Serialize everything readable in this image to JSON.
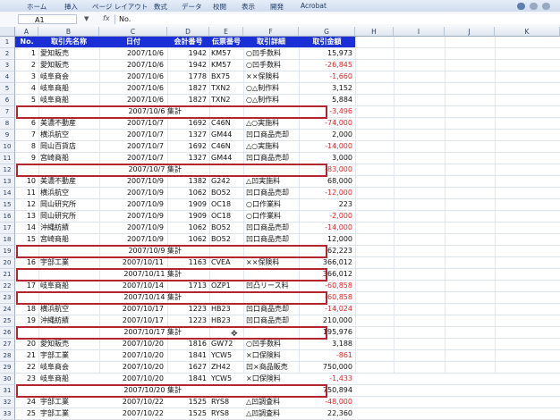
{
  "ribbon": {
    "tabs": [
      "ホーム",
      "挿入",
      "ページ レイアウト",
      "数式",
      "データ",
      "校閲",
      "表示",
      "開発",
      "Acrobat"
    ]
  },
  "formula_bar": {
    "name_box": "A1",
    "fx": "fx",
    "value": "No."
  },
  "columns": [
    "A",
    "B",
    "C",
    "D",
    "E",
    "F",
    "G",
    "H",
    "I",
    "J",
    "K"
  ],
  "header": [
    "No.",
    "取引先名称",
    "日付",
    "会計番号",
    "伝票番号",
    "取引詳細",
    "取引金額"
  ],
  "rows": [
    {
      "row": "2",
      "no": "1",
      "name": "愛知販売",
      "date": "2007/10/6",
      "acct": "1942",
      "slip": "KM57",
      "detail": "○凹手数料",
      "amount": "15,973",
      "neg": false
    },
    {
      "row": "3",
      "no": "2",
      "name": "愛知販売",
      "date": "2007/10/6",
      "acct": "1942",
      "slip": "KM57",
      "detail": "○凹手数料",
      "amount": "-26,845",
      "neg": true
    },
    {
      "row": "4",
      "no": "3",
      "name": "岐阜商会",
      "date": "2007/10/6",
      "acct": "1778",
      "slip": "BX75",
      "detail": "××保険料",
      "amount": "-1,660",
      "neg": true
    },
    {
      "row": "5",
      "no": "4",
      "name": "岐阜商船",
      "date": "2007/10/6",
      "acct": "1827",
      "slip": "TXN2",
      "detail": "○△制作料",
      "amount": "3,152",
      "neg": false
    },
    {
      "row": "6",
      "no": "5",
      "name": "岐阜商船",
      "date": "2007/10/6",
      "acct": "1827",
      "slip": "TXN2",
      "detail": "○△制作料",
      "amount": "5,884",
      "neg": false
    },
    {
      "row": "7",
      "subtotal": "2007/10/6 集計",
      "amount": "-3,496",
      "neg": true
    },
    {
      "row": "8",
      "no": "6",
      "name": "美濃不動産",
      "date": "2007/10/7",
      "acct": "1692",
      "slip": "C46N",
      "detail": "△○実施料",
      "amount": "-74,000",
      "neg": true
    },
    {
      "row": "9",
      "no": "7",
      "name": "横浜航空",
      "date": "2007/10/7",
      "acct": "1327",
      "slip": "GM44",
      "detail": "凹口商品売却",
      "amount": "2,000",
      "neg": false
    },
    {
      "row": "10",
      "no": "8",
      "name": "岡山百貨店",
      "date": "2007/10/7",
      "acct": "1692",
      "slip": "C46N",
      "detail": "△○実施料",
      "amount": "-14,000",
      "neg": true
    },
    {
      "row": "11",
      "no": "9",
      "name": "宮崎商船",
      "date": "2007/10/7",
      "acct": "1327",
      "slip": "GM44",
      "detail": "凹口商品売却",
      "amount": "3,000",
      "neg": false
    },
    {
      "row": "12",
      "subtotal": "2007/10/7 集計",
      "amount": "-83,000",
      "neg": true
    },
    {
      "row": "13",
      "no": "10",
      "name": "美濃不動産",
      "date": "2007/10/9",
      "acct": "1382",
      "slip": "G242",
      "detail": "△凹実施料",
      "amount": "68,000",
      "neg": false
    },
    {
      "row": "14",
      "no": "11",
      "name": "横浜航空",
      "date": "2007/10/9",
      "acct": "1062",
      "slip": "BO52",
      "detail": "凹口商品売却",
      "amount": "-12,000",
      "neg": true
    },
    {
      "row": "15",
      "no": "12",
      "name": "岡山研究所",
      "date": "2007/10/9",
      "acct": "1909",
      "slip": "OC18",
      "detail": "○口作業料",
      "amount": "223",
      "neg": false
    },
    {
      "row": "16",
      "no": "13",
      "name": "岡山研究所",
      "date": "2007/10/9",
      "acct": "1909",
      "slip": "OC18",
      "detail": "○口作業料",
      "amount": "-2,000",
      "neg": true
    },
    {
      "row": "17",
      "no": "14",
      "name": "沖縄紡績",
      "date": "2007/10/9",
      "acct": "1062",
      "slip": "BO52",
      "detail": "凹口商品売却",
      "amount": "-14,000",
      "neg": true
    },
    {
      "row": "18",
      "no": "15",
      "name": "宮崎商船",
      "date": "2007/10/9",
      "acct": "1062",
      "slip": "BO52",
      "detail": "凹口商品売却",
      "amount": "12,000",
      "neg": false
    },
    {
      "row": "19",
      "subtotal": "2007/10/9 集計",
      "amount": "62,223",
      "neg": false
    },
    {
      "row": "20",
      "no": "16",
      "name": "宇部工業",
      "date": "2007/10/11",
      "acct": "1163",
      "slip": "CVEA",
      "detail": "××保険料",
      "amount": "366,012",
      "neg": false
    },
    {
      "row": "21",
      "subtotal": "2007/10/11 集計",
      "amount": "366,012",
      "neg": false
    },
    {
      "row": "22",
      "no": "17",
      "name": "岐阜商船",
      "date": "2007/10/14",
      "acct": "1713",
      "slip": "OZP1",
      "detail": "凹凸リース料",
      "amount": "-60,858",
      "neg": true
    },
    {
      "row": "23",
      "subtotal": "2007/10/14 集計",
      "amount": "-60,858",
      "neg": true
    },
    {
      "row": "24",
      "no": "18",
      "name": "横浜航空",
      "date": "2007/10/17",
      "acct": "1223",
      "slip": "HB23",
      "detail": "凹口商品売却",
      "amount": "-14,024",
      "neg": true
    },
    {
      "row": "25",
      "no": "19",
      "name": "沖縄紡績",
      "date": "2007/10/17",
      "acct": "1223",
      "slip": "HB23",
      "detail": "凹口商品売却",
      "amount": "210,000",
      "neg": false
    },
    {
      "row": "26",
      "subtotal": "2007/10/17 集計",
      "amount": "195,976",
      "neg": false
    },
    {
      "row": "27",
      "no": "20",
      "name": "愛知販売",
      "date": "2007/10/20",
      "acct": "1816",
      "slip": "GW72",
      "detail": "○凹手数料",
      "amount": "3,188",
      "neg": false
    },
    {
      "row": "28",
      "no": "21",
      "name": "宇部工業",
      "date": "2007/10/20",
      "acct": "1841",
      "slip": "YCW5",
      "detail": "×口保険料",
      "amount": "-861",
      "neg": true
    },
    {
      "row": "29",
      "no": "22",
      "name": "岐阜商会",
      "date": "2007/10/20",
      "acct": "1627",
      "slip": "ZH42",
      "detail": "凹×商品販売",
      "amount": "750,000",
      "neg": false
    },
    {
      "row": "30",
      "no": "23",
      "name": "岐阜商船",
      "date": "2007/10/20",
      "acct": "1841",
      "slip": "YCW5",
      "detail": "×口保険料",
      "amount": "-1,433",
      "neg": true
    },
    {
      "row": "31",
      "subtotal": "2007/10/20 集計",
      "amount": "750,894",
      "neg": false
    },
    {
      "row": "32",
      "no": "24",
      "name": "宇部工業",
      "date": "2007/10/22",
      "acct": "1525",
      "slip": "RYS8",
      "detail": "△凹調査料",
      "amount": "-48,000",
      "neg": true
    },
    {
      "row": "33",
      "no": "25",
      "name": "宇部工業",
      "date": "2007/10/22",
      "acct": "1525",
      "slip": "RYS8",
      "detail": "△凹調査料",
      "amount": "22,360",
      "neg": false
    }
  ],
  "colors": {
    "header_bg": "#1b2fd6",
    "negative": "#e2262b",
    "highlight_box": "#b3262e"
  }
}
